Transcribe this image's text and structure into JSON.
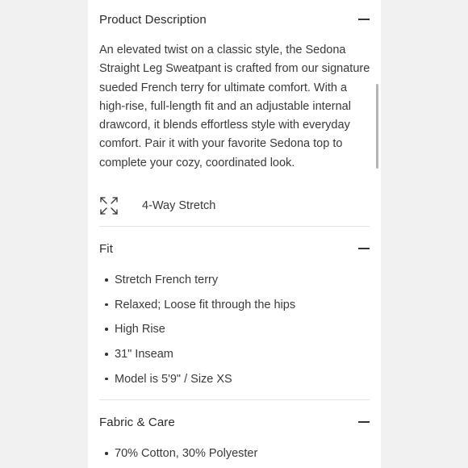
{
  "product_description": {
    "title": "Product Description",
    "text": "An elevated twist on a classic style, the Sedona Straight Leg Sweatpant is crafted from our signature sueded French terry for ultimate comfort. With a high-rise, full-length fit and an adjustable internal drawcord, it blends effortless style with everyday comfort. Pair it with your favorite Sedona top to complete your cozy, coordinated look.",
    "feature_label": "4-Way Stretch",
    "feature_icon": "expand-arrows-icon"
  },
  "fit": {
    "title": "Fit",
    "items": [
      "Stretch French terry",
      "Relaxed; Loose fit through the hips",
      "High Rise",
      "31\" Inseam",
      "Model is 5'9\" / Size XS"
    ]
  },
  "fabric_care": {
    "title": "Fabric & Care",
    "items": [
      "70% Cotton, 30% Polyester"
    ]
  },
  "colors": {
    "page_background": "#f1f1f1",
    "panel_background": "#ffffff",
    "text": "#2b2b2b",
    "divider": "#e3e3e3"
  }
}
